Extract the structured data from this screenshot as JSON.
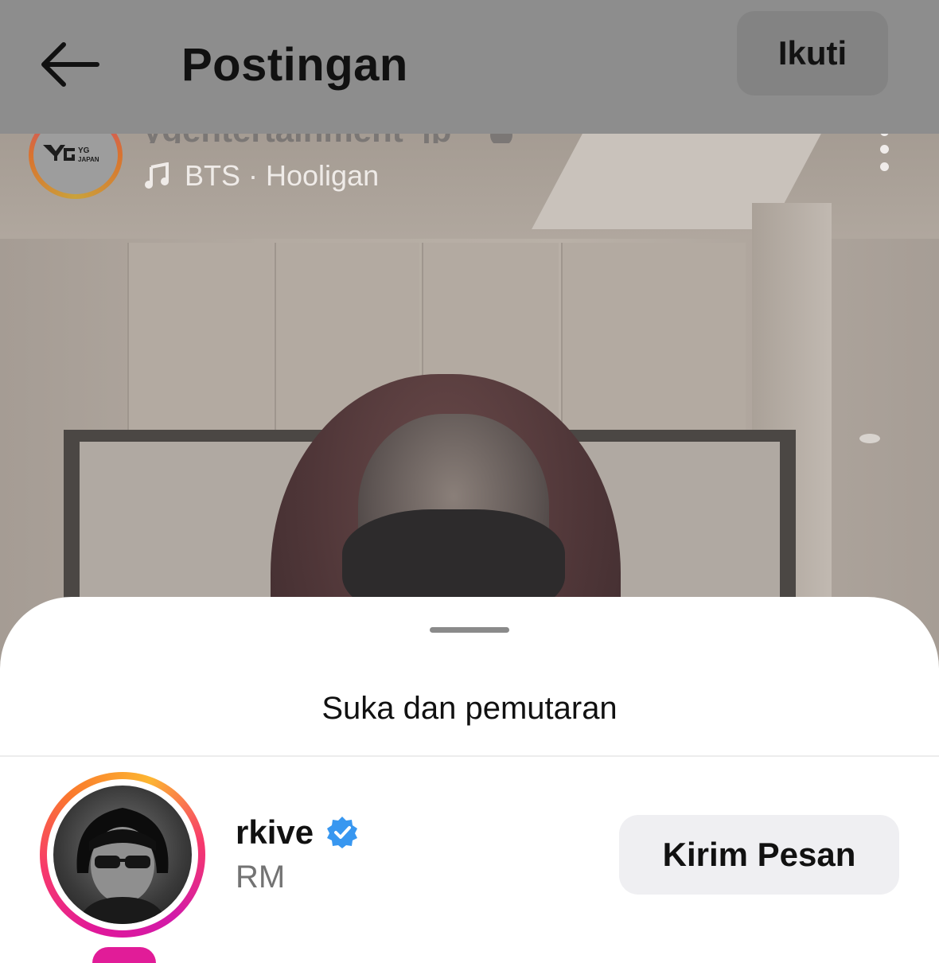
{
  "header": {
    "back_icon": "arrow-left-icon",
    "title": "Postingan",
    "follow_label": "Ikuti"
  },
  "post": {
    "account": "ygentertainment_jp",
    "avatar_logo_top": "YG",
    "avatar_logo_bottom": "JAPAN",
    "verified_icon": "verified-badge-icon",
    "music_icon": "music-note-icon",
    "audio": "BTS · Hooligan",
    "more_icon": "more-vertical-icon"
  },
  "sheet": {
    "title": "Suka dan pemutaran",
    "users": [
      {
        "username": "rkive",
        "full_name": "RM",
        "verified": true,
        "action_label": "Kirim Pesan"
      }
    ]
  },
  "colors": {
    "verified_blue": "#3897f0",
    "topbar_overlay": "#8d8d8d",
    "story_ring": [
      "#e0189a",
      "#f73a6b",
      "#fa7a2c",
      "#fcb531"
    ]
  }
}
